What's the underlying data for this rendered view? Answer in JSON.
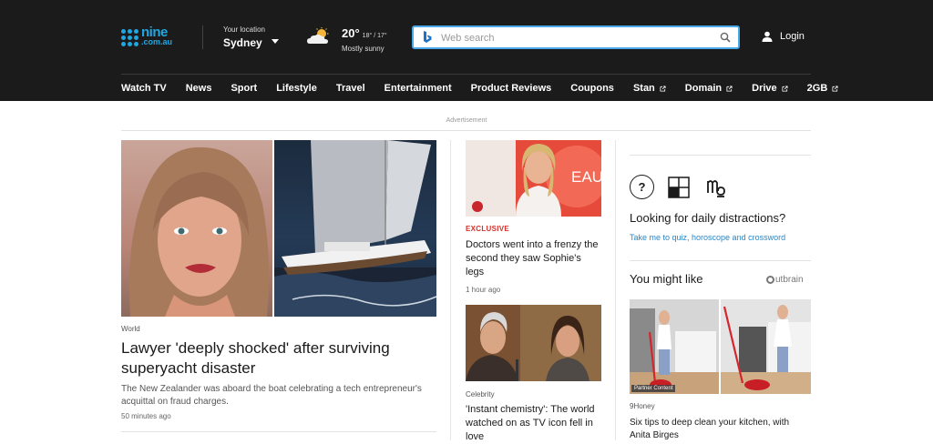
{
  "header": {
    "logo": {
      "line1": "nine",
      "line2": ".com.au"
    },
    "location": {
      "label": "Your location",
      "city": "Sydney"
    },
    "weather": {
      "temp": "20°",
      "hilo": "18° / 17°",
      "condition": "Mostly sunny",
      "icon": "partly-sunny-icon"
    },
    "search": {
      "placeholder": "Web search",
      "value": ""
    },
    "login": {
      "label": "Login"
    }
  },
  "nav": {
    "items": [
      {
        "label": "Watch TV",
        "external": false
      },
      {
        "label": "News",
        "external": false
      },
      {
        "label": "Sport",
        "external": false
      },
      {
        "label": "Lifestyle",
        "external": false
      },
      {
        "label": "Travel",
        "external": false
      },
      {
        "label": "Entertainment",
        "external": false
      },
      {
        "label": "Product Reviews",
        "external": false
      },
      {
        "label": "Coupons",
        "external": false
      },
      {
        "label": "Stan",
        "external": true
      },
      {
        "label": "Domain",
        "external": true
      },
      {
        "label": "Drive",
        "external": true
      },
      {
        "label": "2GB",
        "external": true
      }
    ]
  },
  "ad": {
    "label": "Advertisement"
  },
  "hero": {
    "tag": "World",
    "title": "Lawyer 'deeply shocked' after surviving superyacht disaster",
    "description": "The New Zealander was aboard the boat celebrating a tech entrepreneur's acquittal on fraud charges.",
    "time": "50 minutes ago"
  },
  "middle": {
    "article1": {
      "kicker": "EXCLUSIVE",
      "title": "Doctors went into a frenzy the second they saw Sophie's legs",
      "time": "1 hour ago",
      "image_text": "EAU"
    },
    "article2": {
      "tag": "Celebrity",
      "title": "'Instant chemistry': The world watched on as TV icon fell in love"
    }
  },
  "right": {
    "distractions": {
      "quiz_icon_text": "?",
      "title": "Looking for daily distractions?",
      "link": "Take me to quiz, horoscope and crossword"
    },
    "you_might_like": {
      "title": "You might like",
      "provider": "utbrain",
      "badge": "Partner Content",
      "source": "9Honey",
      "article_title": "Six tips to deep clean your kitchen, with Anita Birges"
    }
  },
  "colors": {
    "header_bg": "#1b1b1b",
    "brand_blue": "#1fa7e1",
    "link_blue": "#2a86c6",
    "kicker_red": "#d6312b"
  }
}
